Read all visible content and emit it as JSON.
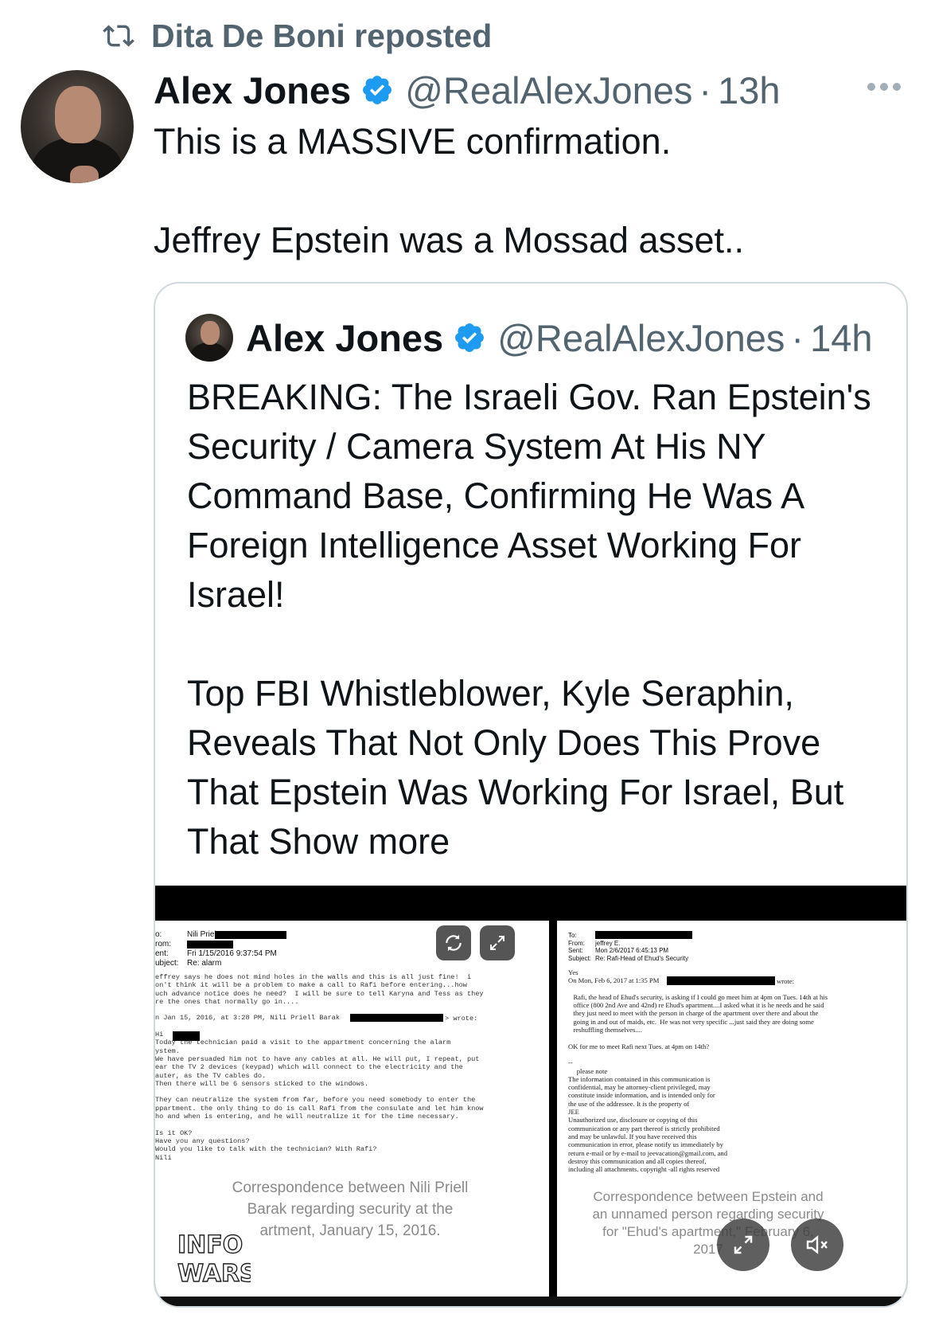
{
  "repost": {
    "text": "Dita De Boni reposted",
    "icon": "repost-icon"
  },
  "post": {
    "author": {
      "name": "Alex Jones",
      "handle": "@RealAlexJones",
      "verified": true,
      "verified_color": "#1d9bf0"
    },
    "separator": "·",
    "time": "13h",
    "text": [
      "This is a MASSIVE confirmation.",
      "Jeffrey Epstein was a Mossad asset.."
    ]
  },
  "quote": {
    "author": {
      "name": "Alex Jones",
      "handle": "@RealAlexJones",
      "verified": true
    },
    "separator": "·",
    "time": "14h",
    "paragraphs": [
      "BREAKING: The Israeli Gov. Ran Epstein's Security / Camera System At His NY Command Base, Confirming He Was A Foreign Intelligence Asset Working For Israel!",
      "Top FBI Whistleblower, Kyle Seraphin, Reveals That Not Only Does This Prove That Epstein Was Working For Israel, But That Show more"
    ],
    "media": {
      "left_doc": {
        "header_labels": [
          "o:",
          "rom:",
          "ent:",
          "ubject:"
        ],
        "header_values": [
          "Nili Priel",
          "",
          "Fri 1/15/2016 9:37:54 PM",
          "Re: alarm"
        ],
        "body": [
          "effrey says he does not mind holes in the walls and this is all just fine!  i",
          "on't think it will be a problem to make a call to Rafi before entering...how",
          "uch advance notice does he need?  I will be sure to tell Karyna and Tess as they",
          "re the ones that normally go in....",
          "",
          "n Jan 15, 2016, at 3:28 PM, Nili Priell Barak",
          "",
          "Hi",
          "Today the technician paid a visit to the appartment concerning the alarm",
          "ystem.",
          "We have persuaded him not to have any cables at all. He will put, I repeat, put",
          "ear the TV 2 devices (keypad) which will connect to the electricity and the",
          "auter, as the TV cables do.",
          "Then there will be 6 sensors sticked to the windows.",
          "",
          "They can neutralize the system from far, before you need somebody to enter the",
          "ppartment. the only thing to do is call Rafi from the consulate and let him know",
          "ho and when is entering, and he will neutralize it for the time necessary.",
          "",
          "Is it OK?",
          "Have you any questions?",
          "Would you like to talk with the technician? With Rafi?",
          "Nili"
        ],
        "wrote_label": "> wrote:",
        "caption": "Correspondence between Nili Priell Barak regarding security at the apartment, January 15, 2016.",
        "caption_lines": [
          "Correspondence between Nili Priell",
          "Barak regarding security at the",
          "artment, January 15, 2016."
        ]
      },
      "right_doc": {
        "header_labels": [
          "To:",
          "From:",
          "Sent:",
          "Subject:"
        ],
        "header_values": [
          "",
          "jeffrey E.",
          "Mon 2/6/2017 6:45:13 PM",
          "Re: Rafi-Head of Ehud's Security"
        ],
        "body": [
          "Yes",
          "On Mon, Feb 6, 2017 at 1:35 PM",
          "",
          "   Rafi, the head of Ehud's security, is asking if I could go meet him at 4pm on Tues. 14th at his",
          "   office (800 2nd Ave and 42nd) re Ehud's apartment....I asked what it is he needs and he said",
          "   they just need to meet with the person in charge of the apartment over there and about the",
          "   going in and out of maids, etc.  He was not very specific ...just said they are doing some",
          "   reshuffling themselves....",
          "",
          "OK for me to meet Rafi next Tues. at 4pm on 14th?",
          "",
          "--",
          "     please note",
          "The information contained in this communication is",
          "confidential, may be attorney-client privileged, may",
          "constitute inside information, and is intended only for",
          "the use of the addressee. It is the property of",
          "JEE",
          "Unauthorized use, disclosure or copying of this",
          "communication or any part thereof is strictly prohibited",
          "and may be unlawful. If you have received this",
          "communication in error, please notify us immediately by",
          "return e-mail or by e-mail to jeevacation@gmail.com, and",
          "destroy this communication and all copies thereof,",
          "including all attachments. copyright -all rights reserved"
        ],
        "wrote_label": "wrote:",
        "caption_lines": [
          "Correspondence between Epstein and",
          "an unnamed person regarding security",
          "for \"Ehud's apartment,\" February 6,",
          "2017"
        ]
      },
      "logo_text": "INFO WARS",
      "controls": [
        "refresh-icon",
        "expand-icon",
        "fullscreen-icon",
        "mute-icon"
      ]
    }
  }
}
